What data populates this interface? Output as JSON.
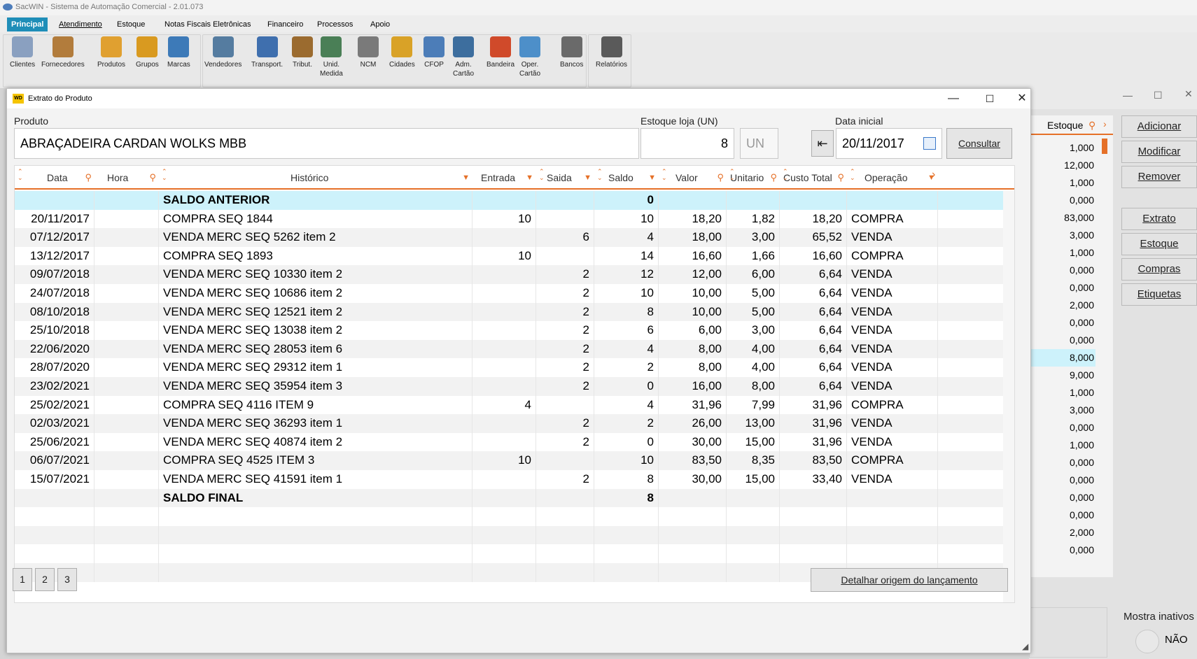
{
  "app": {
    "title": "SacWIN - Sistema de Automação Comercial - 2.01.073",
    "menu": [
      "Principal",
      "Atendimento",
      "Estoque",
      "Notas Fiscais Eletrônicas",
      "Financeiro",
      "Processos",
      "Apoio"
    ]
  },
  "ribbon": [
    {
      "label": "Clientes",
      "icon": "clients-icon",
      "color": "#8aa0c0"
    },
    {
      "label": "Fornecedores",
      "icon": "supplier-icon",
      "color": "#b27c3c"
    },
    {
      "label": "Produtos",
      "icon": "box-icon",
      "color": "#e0a030"
    },
    {
      "label": "Grupos",
      "icon": "lasso-icon",
      "color": "#d99a20"
    },
    {
      "label": "Marcas",
      "icon": "brands-icon",
      "color": "#3d7ab8"
    },
    {
      "label": "Vendedores",
      "icon": "sellers-icon",
      "color": "#557ca0"
    },
    {
      "label": "Transport.",
      "icon": "truck-icon",
      "color": "#3f6fae"
    },
    {
      "label": "Tribut.",
      "icon": "boxes-icon",
      "color": "#9b6b2f"
    },
    {
      "label": "Unid.\nMedida",
      "icon": "measure-icon",
      "color": "#4a7f56"
    },
    {
      "label": "NCM",
      "icon": "ncm-icon",
      "color": "#7a7a7a"
    },
    {
      "label": "Cidades",
      "icon": "building-icon",
      "color": "#d9a227"
    },
    {
      "label": "CFOP",
      "icon": "cfop-icon",
      "color": "#4c7db8"
    },
    {
      "label": "Adm.\nCartão",
      "icon": "card-admin-icon",
      "color": "#3d6e9e"
    },
    {
      "label": "Bandeira",
      "icon": "flag-card-icon",
      "color": "#d04a2a"
    },
    {
      "label": "Oper.\nCartão",
      "icon": "card-icon",
      "color": "#4d8fc9"
    },
    {
      "label": "Bancos",
      "icon": "safe-icon",
      "color": "#6a6a6a"
    },
    {
      "label": "Relatórios",
      "icon": "report-icon",
      "color": "#5a5a5a"
    }
  ],
  "background_window": {
    "estoque_header": "Estoque",
    "estoque_values": [
      "1,000",
      "12,000",
      "1,000",
      "0,000",
      "83,000",
      "3,000",
      "1,000",
      "0,000",
      "0,000",
      "2,000",
      "0,000",
      "0,000",
      "8,000",
      "9,000",
      "1,000",
      "3,000",
      "0,000",
      "1,000",
      "0,000",
      "0,000",
      "0,000",
      "0,000",
      "2,000",
      "0,000"
    ],
    "buttons": [
      "Adicionar",
      "Modificar",
      "Remover",
      "Extrato",
      "Estoque",
      "Compras",
      "Etiquetas"
    ],
    "mostra_inativos": "Mostra inativos",
    "mostra_value": "NÃO"
  },
  "dialog": {
    "title": "Extrato do Produto",
    "produto_label": "Produto",
    "produto_value": "ABRAÇADEIRA CARDAN WOLKS MBB",
    "estoque_label": "Estoque loja (UN)",
    "estoque_value": "8",
    "unit": "UN",
    "data_label": "Data inicial",
    "data_value": "20/11/2017",
    "consultar": "Consultar",
    "columns": [
      "Data",
      "Hora",
      "Histórico",
      "Entrada",
      "Saida",
      "Saldo",
      "Valor",
      "Unitario",
      "Custo Total",
      "Operação"
    ],
    "rows": [
      {
        "data": "",
        "hora": "",
        "historico": "SALDO ANTERIOR",
        "entrada": "",
        "saida": "",
        "saldo": "0",
        "valor": "",
        "unitario": "",
        "custo": "",
        "operacao": ""
      },
      {
        "data": "20/11/2017",
        "hora": "",
        "historico": "COMPRA SEQ 1844",
        "entrada": "10",
        "saida": "",
        "saldo": "10",
        "valor": "18,20",
        "unitario": "1,82",
        "custo": "18,20",
        "operacao": "COMPRA"
      },
      {
        "data": "07/12/2017",
        "hora": "",
        "historico": "VENDA MERC SEQ 5262 item 2",
        "entrada": "",
        "saida": "6",
        "saldo": "4",
        "valor": "18,00",
        "unitario": "3,00",
        "custo": "65,52",
        "operacao": "VENDA"
      },
      {
        "data": "13/12/2017",
        "hora": "",
        "historico": "COMPRA SEQ 1893",
        "entrada": "10",
        "saida": "",
        "saldo": "14",
        "valor": "16,60",
        "unitario": "1,66",
        "custo": "16,60",
        "operacao": "COMPRA"
      },
      {
        "data": "09/07/2018",
        "hora": "",
        "historico": "VENDA MERC SEQ 10330 item 2",
        "entrada": "",
        "saida": "2",
        "saldo": "12",
        "valor": "12,00",
        "unitario": "6,00",
        "custo": "6,64",
        "operacao": "VENDA"
      },
      {
        "data": "24/07/2018",
        "hora": "",
        "historico": "VENDA MERC SEQ 10686 item 2",
        "entrada": "",
        "saida": "2",
        "saldo": "10",
        "valor": "10,00",
        "unitario": "5,00",
        "custo": "6,64",
        "operacao": "VENDA"
      },
      {
        "data": "08/10/2018",
        "hora": "",
        "historico": "VENDA MERC SEQ 12521 item 2",
        "entrada": "",
        "saida": "2",
        "saldo": "8",
        "valor": "10,00",
        "unitario": "5,00",
        "custo": "6,64",
        "operacao": "VENDA"
      },
      {
        "data": "25/10/2018",
        "hora": "",
        "historico": "VENDA MERC SEQ 13038 item 2",
        "entrada": "",
        "saida": "2",
        "saldo": "6",
        "valor": "6,00",
        "unitario": "3,00",
        "custo": "6,64",
        "operacao": "VENDA"
      },
      {
        "data": "22/06/2020",
        "hora": "",
        "historico": "VENDA MERC SEQ 28053 item 6",
        "entrada": "",
        "saida": "2",
        "saldo": "4",
        "valor": "8,00",
        "unitario": "4,00",
        "custo": "6,64",
        "operacao": "VENDA"
      },
      {
        "data": "28/07/2020",
        "hora": "",
        "historico": "VENDA MERC SEQ 29312 item 1",
        "entrada": "",
        "saida": "2",
        "saldo": "2",
        "valor": "8,00",
        "unitario": "4,00",
        "custo": "6,64",
        "operacao": "VENDA"
      },
      {
        "data": "23/02/2021",
        "hora": "",
        "historico": "VENDA MERC SEQ 35954 item 3",
        "entrada": "",
        "saida": "2",
        "saldo": "0",
        "valor": "16,00",
        "unitario": "8,00",
        "custo": "6,64",
        "operacao": "VENDA"
      },
      {
        "data": "25/02/2021",
        "hora": "",
        "historico": "COMPRA SEQ 4116 ITEM 9",
        "entrada": "4",
        "saida": "",
        "saldo": "4",
        "valor": "31,96",
        "unitario": "7,99",
        "custo": "31,96",
        "operacao": "COMPRA"
      },
      {
        "data": "02/03/2021",
        "hora": "",
        "historico": "VENDA MERC SEQ 36293 item 1",
        "entrada": "",
        "saida": "2",
        "saldo": "2",
        "valor": "26,00",
        "unitario": "13,00",
        "custo": "31,96",
        "operacao": "VENDA"
      },
      {
        "data": "25/06/2021",
        "hora": "",
        "historico": "VENDA MERC SEQ 40874 item 2",
        "entrada": "",
        "saida": "2",
        "saldo": "0",
        "valor": "30,00",
        "unitario": "15,00",
        "custo": "31,96",
        "operacao": "VENDA"
      },
      {
        "data": "06/07/2021",
        "hora": "",
        "historico": "COMPRA SEQ 4525 ITEM 3",
        "entrada": "10",
        "saida": "",
        "saldo": "10",
        "valor": "83,50",
        "unitario": "8,35",
        "custo": "83,50",
        "operacao": "COMPRA"
      },
      {
        "data": "15/07/2021",
        "hora": "",
        "historico": "VENDA MERC SEQ 41591 item 1",
        "entrada": "",
        "saida": "2",
        "saldo": "8",
        "valor": "30,00",
        "unitario": "15,00",
        "custo": "33,40",
        "operacao": "VENDA"
      },
      {
        "data": "",
        "hora": "",
        "historico": "SALDO FINAL",
        "entrada": "",
        "saida": "",
        "saldo": "8",
        "valor": "",
        "unitario": "",
        "custo": "",
        "operacao": ""
      }
    ],
    "pages": [
      "1",
      "2",
      "3"
    ],
    "detalhar": "Detalhar origem do lançamento"
  },
  "colors": {
    "accent": "#e57028",
    "menu_active": "#1f8eb8",
    "selected_row": "#cdf2fb"
  }
}
